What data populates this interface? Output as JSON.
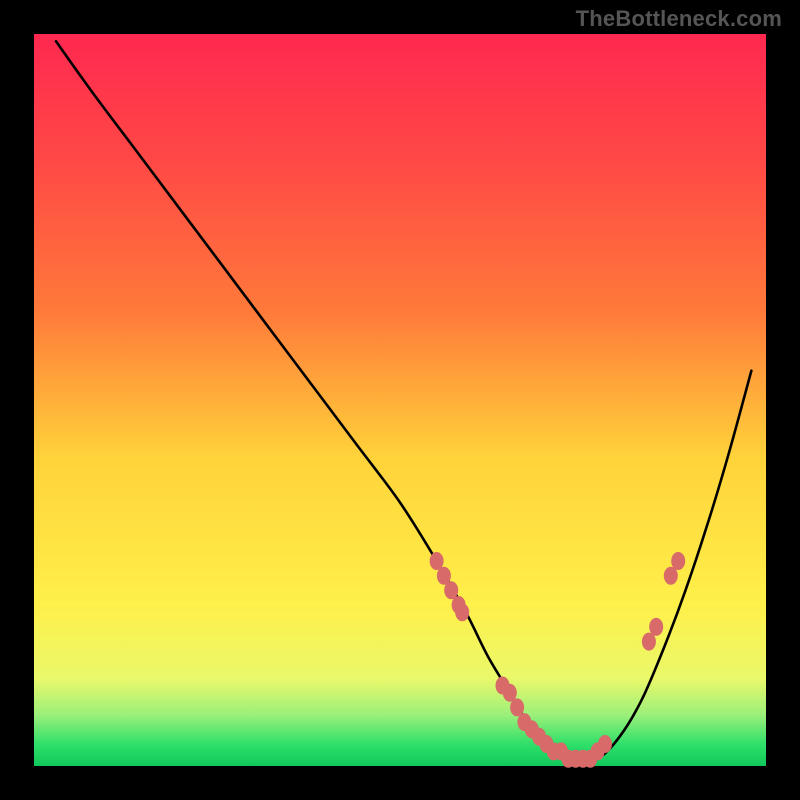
{
  "watermark": "TheBottleneck.com",
  "colors": {
    "bg": "#000000",
    "watermark": "#555555",
    "curve": "#000000",
    "marker_fill": "#d86a6a",
    "marker_stroke": "#c05050",
    "gradient_top": "#ff2850",
    "gradient_mid_upper": "#ff7a3a",
    "gradient_mid": "#ffd33a",
    "gradient_mid_lower": "#fff04a",
    "gradient_green_light": "#9cf07a",
    "gradient_green": "#2fe06a",
    "gradient_green_deep": "#10c85a"
  },
  "chart_data": {
    "type": "line",
    "title": "",
    "xlabel": "",
    "ylabel": "",
    "xlim": [
      0,
      100
    ],
    "ylim": [
      0,
      100
    ],
    "description": "Bottleneck percentage curve: steep drop from top-left to a near-zero minimum around x≈67–78, then rising again toward the right edge. Pink dots highlight sampled points along the curve near the trough.",
    "series": [
      {
        "name": "bottleneck-curve",
        "x": [
          3,
          8,
          14,
          20,
          26,
          32,
          38,
          44,
          50,
          55,
          59,
          62,
          65,
          68,
          71,
          74,
          77,
          80,
          83,
          86,
          89,
          92,
          95,
          98
        ],
        "y": [
          99,
          92,
          84,
          76,
          68,
          60,
          52,
          44,
          36,
          28,
          21,
          15,
          10,
          5,
          2,
          1,
          1,
          4,
          9,
          16,
          24,
          33,
          43,
          54
        ]
      },
      {
        "name": "sample-points",
        "x": [
          55,
          56,
          57,
          58,
          58.5,
          64,
          65,
          66,
          67,
          68,
          69,
          70,
          71,
          72,
          73,
          74,
          75,
          76,
          77,
          78,
          84,
          85,
          87,
          88
        ],
        "y": [
          28,
          26,
          24,
          22,
          21,
          11,
          10,
          8,
          6,
          5,
          4,
          3,
          2,
          2,
          1,
          1,
          1,
          1,
          2,
          3,
          17,
          19,
          26,
          28
        ]
      }
    ]
  }
}
